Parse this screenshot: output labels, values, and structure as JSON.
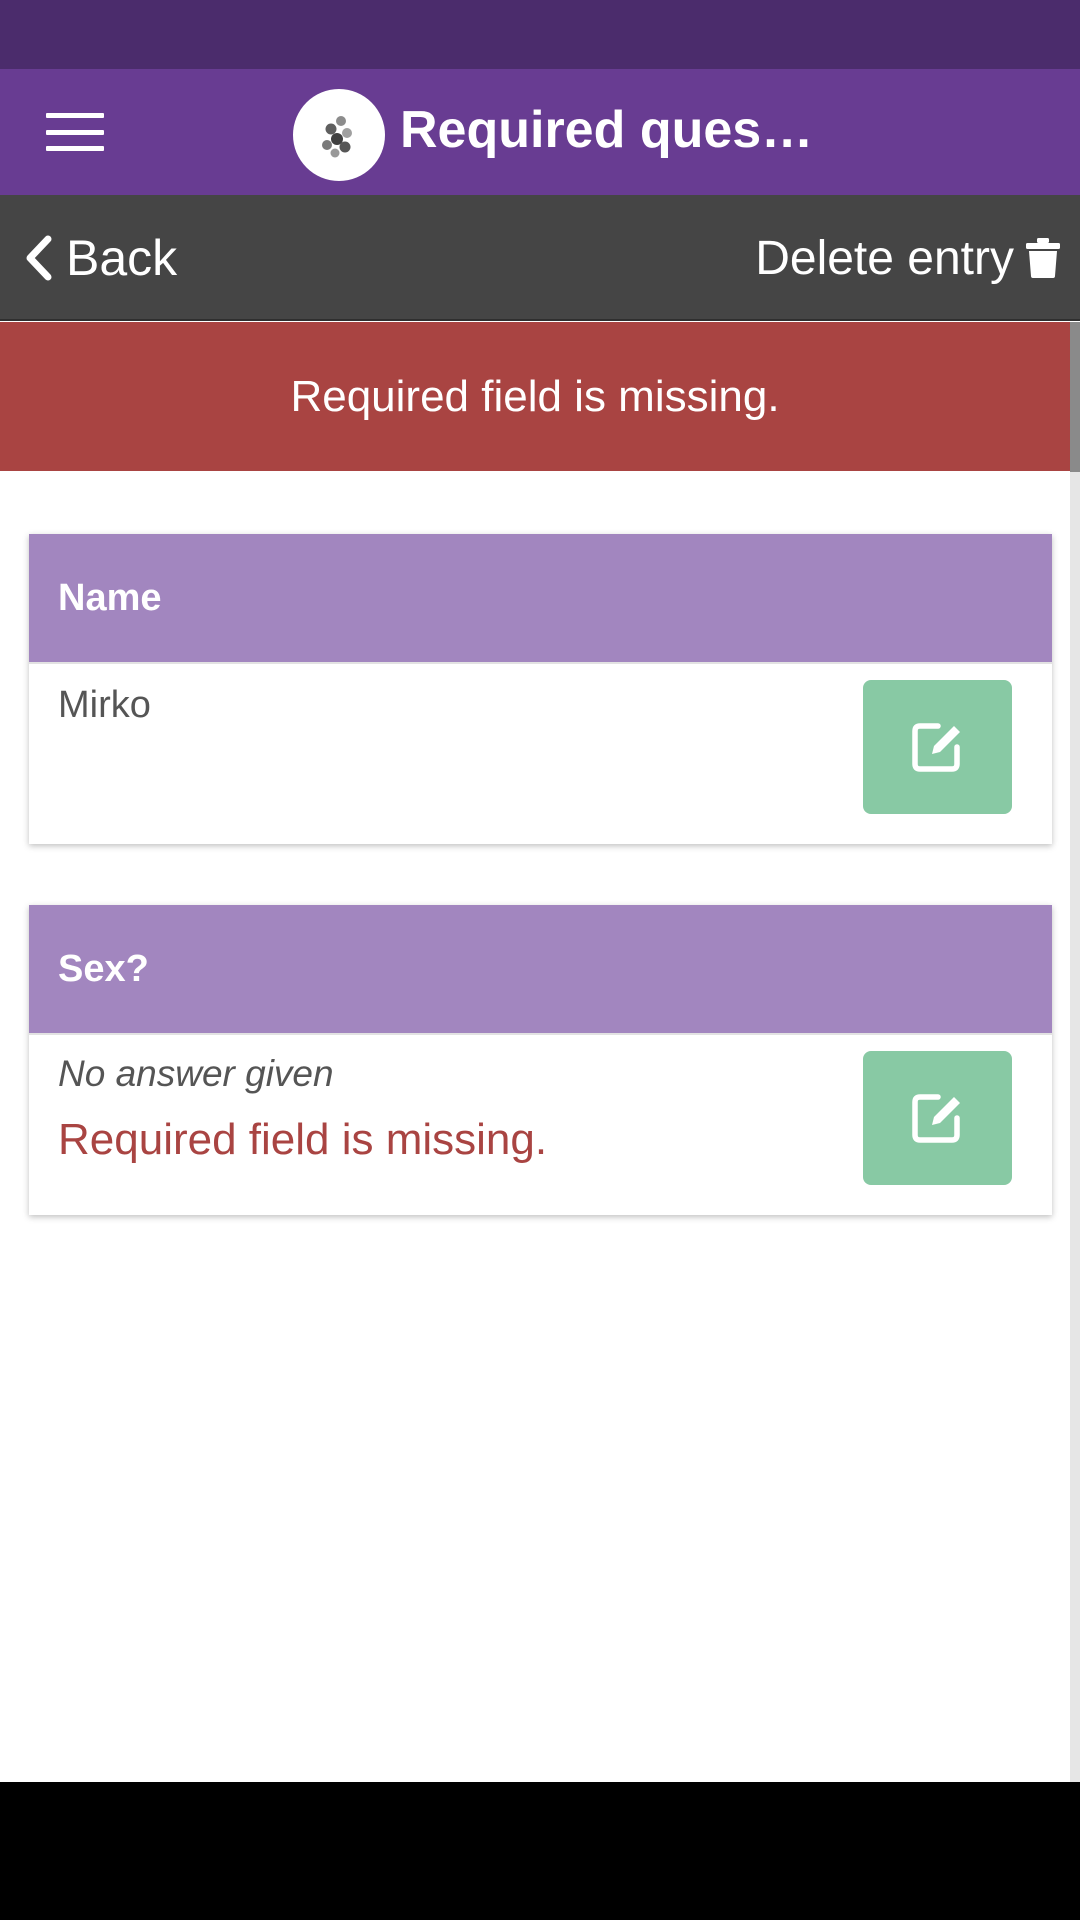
{
  "app_bar": {
    "title": "Required ques…",
    "menu_icon": "hamburger-menu-icon",
    "logo_icon": "app-logo-icon"
  },
  "nav": {
    "back_label": "Back",
    "back_icon": "chevron-left-icon",
    "delete_label": "Delete entry",
    "delete_icon": "trash-icon"
  },
  "banner": {
    "message": "Required field is missing."
  },
  "questions": [
    {
      "label": "Name",
      "answer": "Mirko",
      "edit_icon": "edit-icon"
    },
    {
      "label": "Sex?",
      "answer": "No answer given",
      "error": "Required field is missing.",
      "edit_icon": "edit-icon"
    }
  ],
  "colors": {
    "status_bar": "#4b2c6c",
    "app_bar": "#683c92",
    "nav_bar": "#454545",
    "error": "#a94442",
    "card_header": "#a286bf",
    "edit_button": "#88c9a4"
  }
}
